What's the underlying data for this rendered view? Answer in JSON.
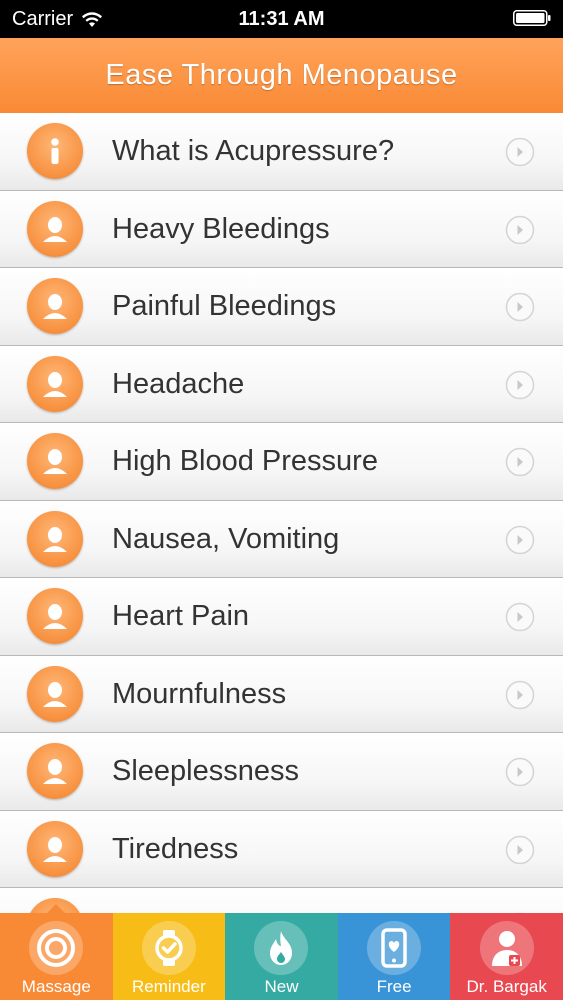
{
  "status_bar": {
    "carrier": "Carrier",
    "time": "11:31 AM"
  },
  "header": {
    "title": "Ease Through Menopause"
  },
  "list": {
    "items": [
      {
        "label": "What is Acupressure?",
        "icon": "info-icon"
      },
      {
        "label": "Heavy Bleedings",
        "icon": "person-icon"
      },
      {
        "label": "Painful Bleedings",
        "icon": "person-icon"
      },
      {
        "label": "Headache",
        "icon": "person-icon"
      },
      {
        "label": "High Blood Pressure",
        "icon": "person-icon"
      },
      {
        "label": "Nausea, Vomiting",
        "icon": "person-icon"
      },
      {
        "label": "Heart Pain",
        "icon": "person-icon"
      },
      {
        "label": "Mournfulness",
        "icon": "person-icon"
      },
      {
        "label": "Sleeplessness",
        "icon": "person-icon"
      },
      {
        "label": "Tiredness",
        "icon": "person-icon"
      },
      {
        "label": "",
        "icon": "person-icon"
      }
    ]
  },
  "tab_bar": {
    "tabs": [
      {
        "label": "Massage",
        "icon": "massage-target-icon",
        "color": "#f98a35",
        "selected": true
      },
      {
        "label": "Reminder",
        "icon": "watch-icon",
        "color": "#f7bd16"
      },
      {
        "label": "New",
        "icon": "flame-icon",
        "color": "#35aaa2"
      },
      {
        "label": "Free",
        "icon": "phone-heart-icon",
        "color": "#3894d6"
      },
      {
        "label": "Dr. Bargak",
        "icon": "doctor-icon",
        "color": "#e8484f"
      }
    ]
  },
  "colors": {
    "accent": "#f98a35",
    "text": "#333333"
  }
}
